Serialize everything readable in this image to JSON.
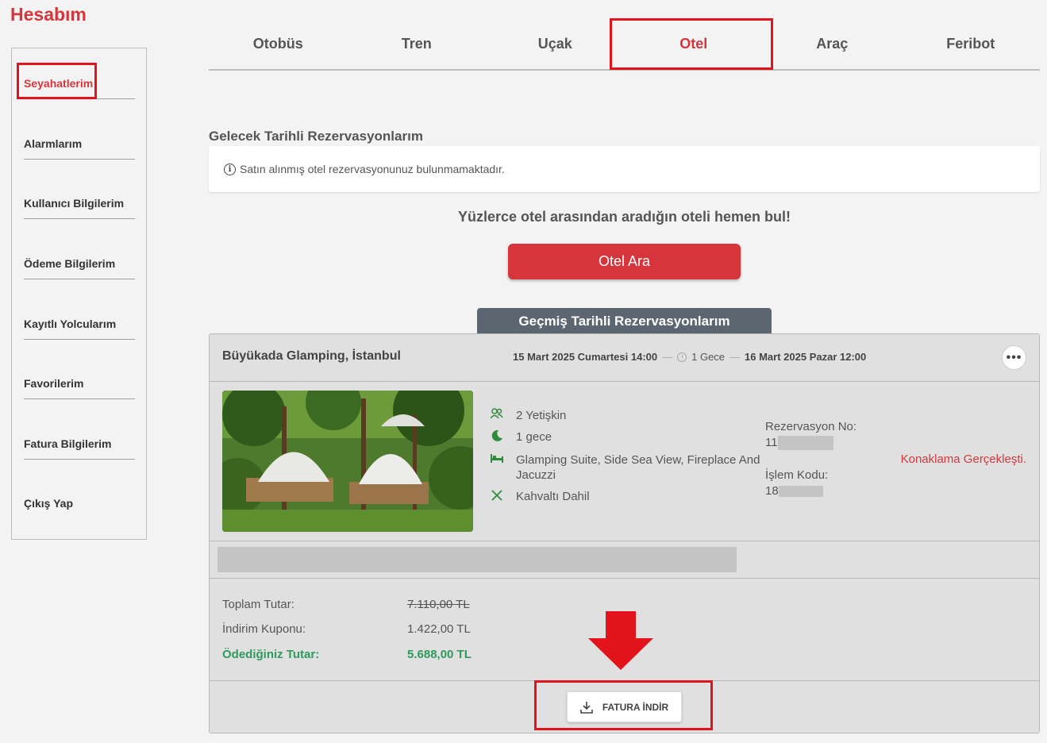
{
  "page_title": "Hesabım",
  "sidebar": {
    "items": [
      {
        "label": "Seyahatlerim",
        "active": true
      },
      {
        "label": "Alarmlarım"
      },
      {
        "label": "Kullanıcı Bilgilerim"
      },
      {
        "label": "Ödeme Bilgilerim"
      },
      {
        "label": "Kayıtlı Yolcularım"
      },
      {
        "label": "Favorilerim"
      },
      {
        "label": "Fatura Bilgilerim"
      },
      {
        "label": "Çıkış Yap"
      }
    ]
  },
  "tabs": [
    {
      "label": "Otobüs"
    },
    {
      "label": "Tren"
    },
    {
      "label": "Uçak"
    },
    {
      "label": "Otel",
      "active": true
    },
    {
      "label": "Araç"
    },
    {
      "label": "Feribot"
    }
  ],
  "upcoming": {
    "title": "Gelecek Tarihli Rezervasyonlarım",
    "empty_message": "Satın alınmış otel rezervasyonunuz bulunmamaktadır.",
    "promo": "Yüzlerce otel arasından aradığın oteli hemen bul!",
    "search_button": "Otel Ara"
  },
  "past": {
    "title": "Geçmiş Tarihli Rezervasyonlarım",
    "reservation": {
      "hotel_name": "Büyükada Glamping, İstanbul",
      "checkin": "15 Mart 2025 Cumartesi 14:00",
      "nights": "1 Gece",
      "checkout": "16 Mart 2025 Pazar 12:00",
      "more_label": "•••",
      "guests": "2 Yetişkin",
      "night_count": "1 gece",
      "room": "Glamping Suite, Side Sea View, Fireplace And Jacuzzi",
      "board": "Kahvaltı Dahil",
      "rez_no_label": "Rezervasyon No:",
      "rez_no_prefix": "11",
      "islem_label": "İşlem Kodu:",
      "islem_prefix": "18",
      "status": "Konaklama Gerçekleşti.",
      "total_label": "Toplam Tutar:",
      "total_value": "7.110,00 TL",
      "coupon_label": "İndirim Kuponu:",
      "coupon_value": "1.422,00 TL",
      "paid_label": "Ödediğiniz Tutar:",
      "paid_value": "5.688,00 TL",
      "invoice_button": "FATURA İNDİR"
    }
  },
  "colors": {
    "brand_red": "#d6363b",
    "green": "#2e9a5c",
    "highlight": "#e2131a"
  }
}
